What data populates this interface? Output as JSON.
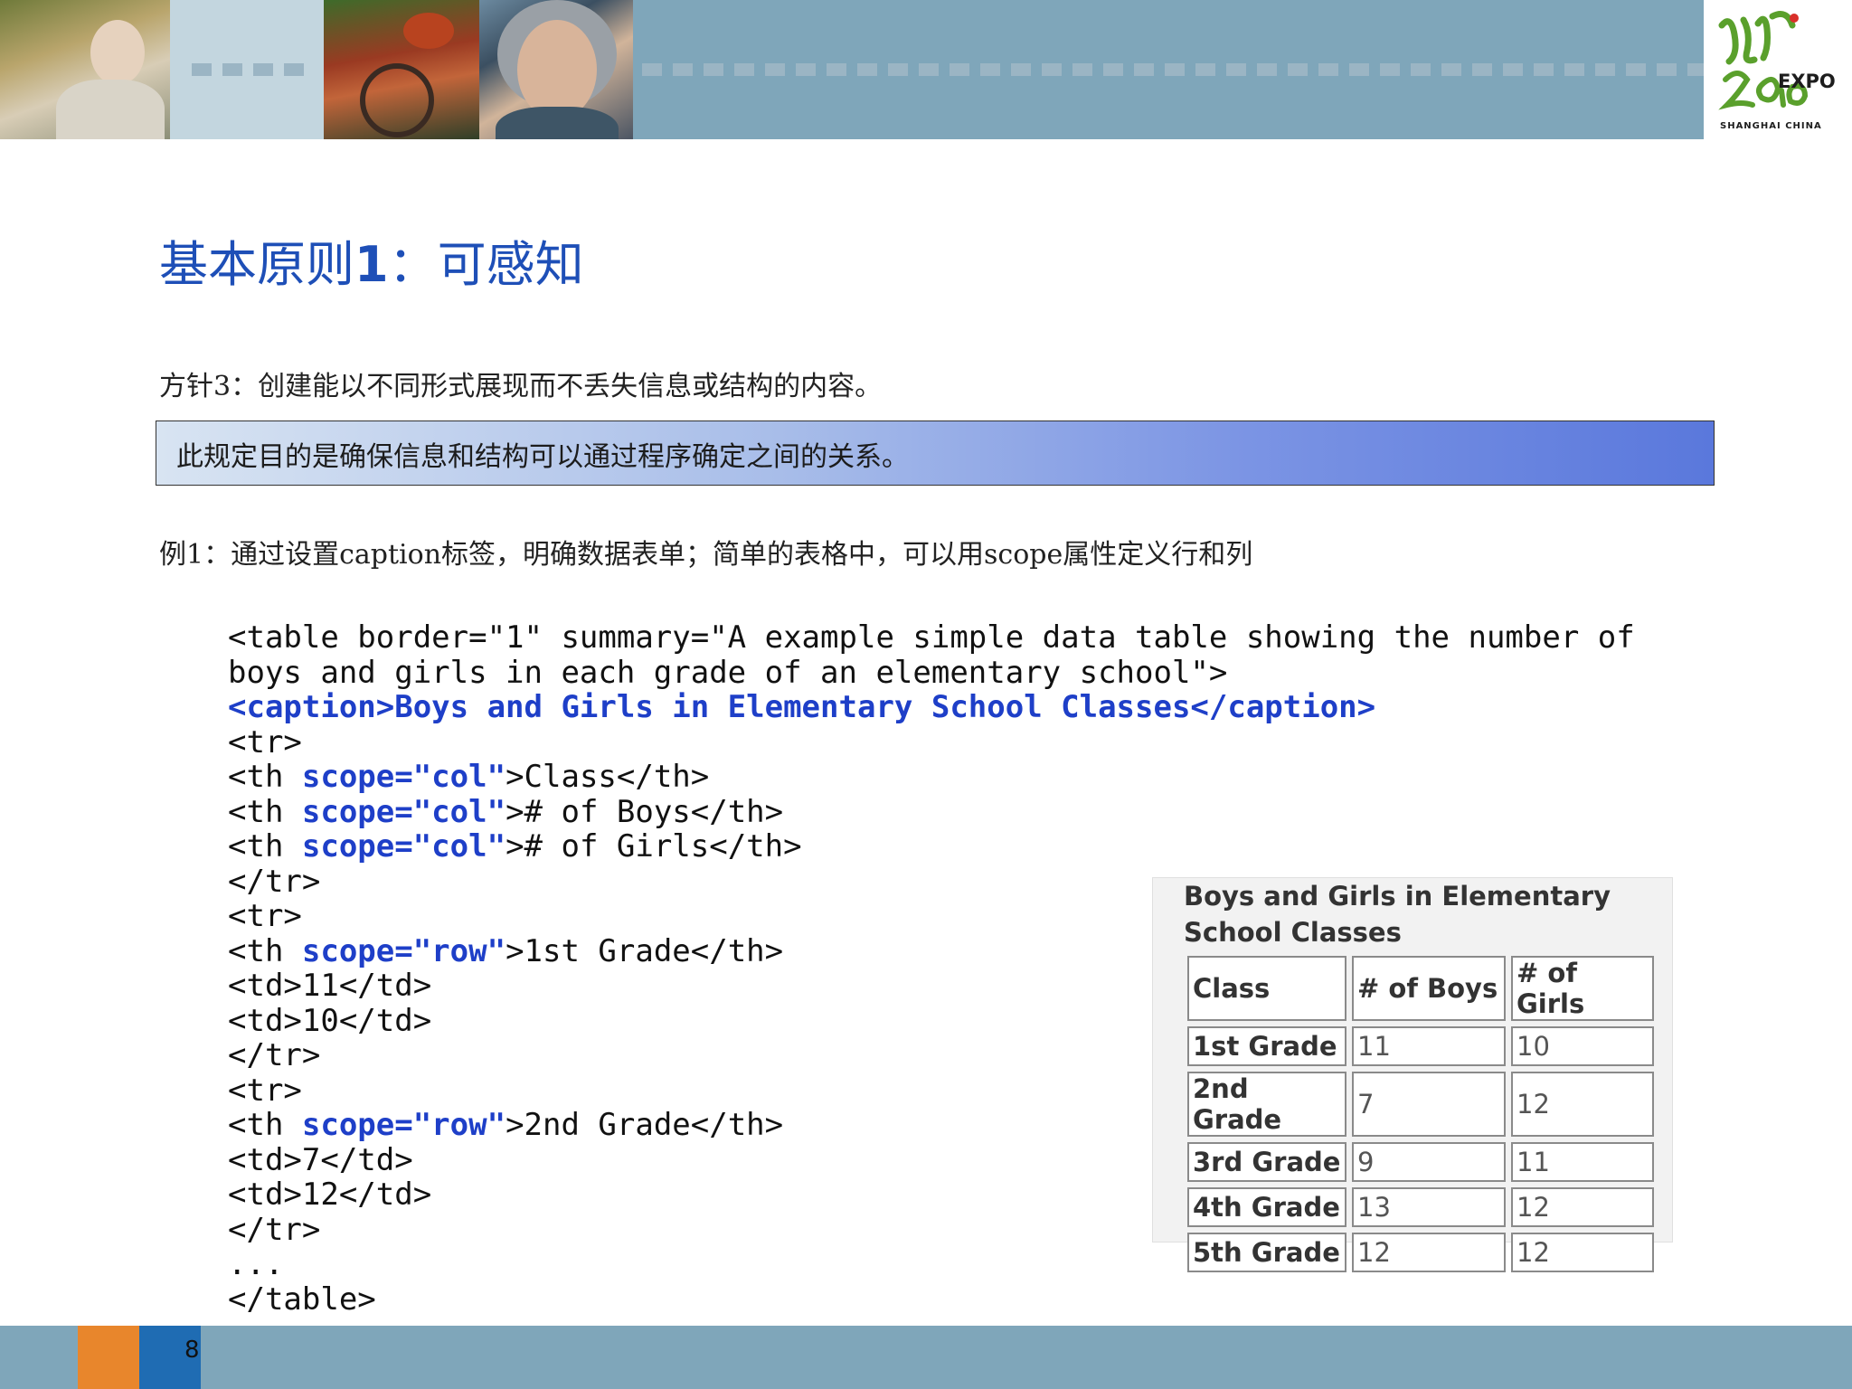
{
  "header": {
    "logo_text": "EXPO",
    "logo_subtext": "SHANGHAI CHINA",
    "logo_mark": "2010"
  },
  "slide": {
    "title_prefix": "基本原则",
    "title_number": "1",
    "title_suffix": "：可感知",
    "guideline": "方针3：创建能以不同形式展现而不丢失信息或结构的内容。",
    "purpose": "此规定目的是确保信息和结构可以通过程序确定之间的关系。",
    "example": "例1：通过设置caption标签，明确数据表单；简单的表格中，可以用scope属性定义行和列",
    "page_number": "8"
  },
  "code": {
    "l1": "<table border=\"1\" summary=\"A example simple data table showing the number of",
    "l2": "boys and girls in each grade of an elementary school\">",
    "l3": "<caption>Boys and Girls in Elementary School Classes</caption>",
    "l4": "<tr>",
    "th_open": "<th ",
    "scope_col": "scope=\"col\"",
    "scope_row": "scope=\"row\"",
    "l5_rest": ">Class</th>",
    "l6_rest": "># of Boys</th>",
    "l7_rest": "># of Girls</th>",
    "l8": "</tr>",
    "l9": "<tr>",
    "l10_rest": ">1st Grade</th>",
    "l11": "<td>11</td>",
    "l12": "<td>10</td>",
    "l13": "</tr>",
    "l14": "<tr>",
    "l15_rest": ">2nd Grade</th>",
    "l16": "<td>7</td>",
    "l17": "<td>12</td>",
    "l18": "</tr>",
    "l19": "...",
    "l20": "</table>"
  },
  "rendered_table": {
    "caption": "Boys and Girls in Elementary School Classes",
    "headers": [
      "Class",
      "# of Boys",
      "# of Girls"
    ],
    "rows": [
      [
        "1st Grade",
        "11",
        "10"
      ],
      [
        "2nd Grade",
        "7",
        "12"
      ],
      [
        "3rd Grade",
        "9",
        "11"
      ],
      [
        "4th Grade",
        "13",
        "12"
      ],
      [
        "5th Grade",
        "12",
        "12"
      ]
    ]
  },
  "colors": {
    "banner": "#7fa6ba",
    "title": "#1e4fb7",
    "code_keyword": "#1e3fc8",
    "footer_orange": "#e8862c",
    "footer_blue": "#1f6cb3"
  }
}
